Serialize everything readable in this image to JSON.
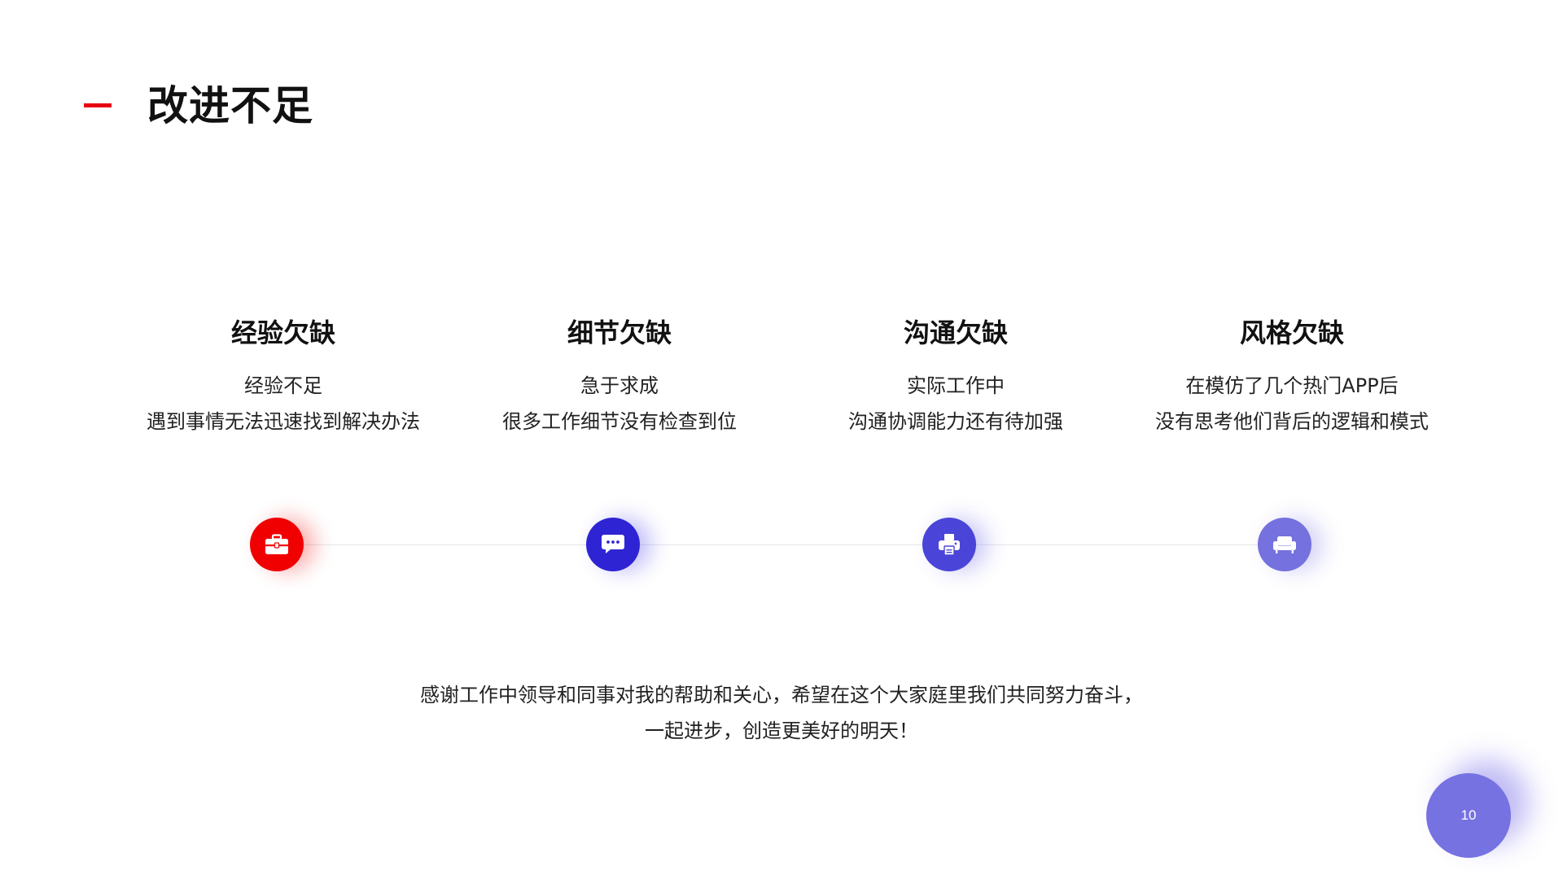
{
  "header": {
    "title": "改进不足"
  },
  "colors": {
    "accent_red": "#e60012",
    "node_1": "#f00000",
    "node_2": "#2f24d4",
    "node_3": "#4a45d8",
    "node_4": "#7571de",
    "page_badge": "#7772e2"
  },
  "items": [
    {
      "title": "经验欠缺",
      "lines": [
        "经验不足",
        "遇到事情无法迅速找到解决办法"
      ],
      "icon": "briefcase-icon"
    },
    {
      "title": "细节欠缺",
      "lines": [
        "急于求成",
        "很多工作细节没有检查到位"
      ],
      "icon": "chat-bubble-icon"
    },
    {
      "title": "沟通欠缺",
      "lines": [
        "实际工作中",
        "沟通协调能力还有待加强"
      ],
      "icon": "printer-icon"
    },
    {
      "title": "风格欠缺",
      "lines": [
        "在模仿了几个热门APP后",
        "没有思考他们背后的逻辑和模式"
      ],
      "icon": "sofa-icon"
    }
  ],
  "closing": {
    "lines": [
      "感谢工作中领导和同事对我的帮助和关心，希望在这个大家庭里我们共同努力奋斗，",
      "一起进步，创造更美好的明天！"
    ]
  },
  "page": {
    "number": "10"
  }
}
